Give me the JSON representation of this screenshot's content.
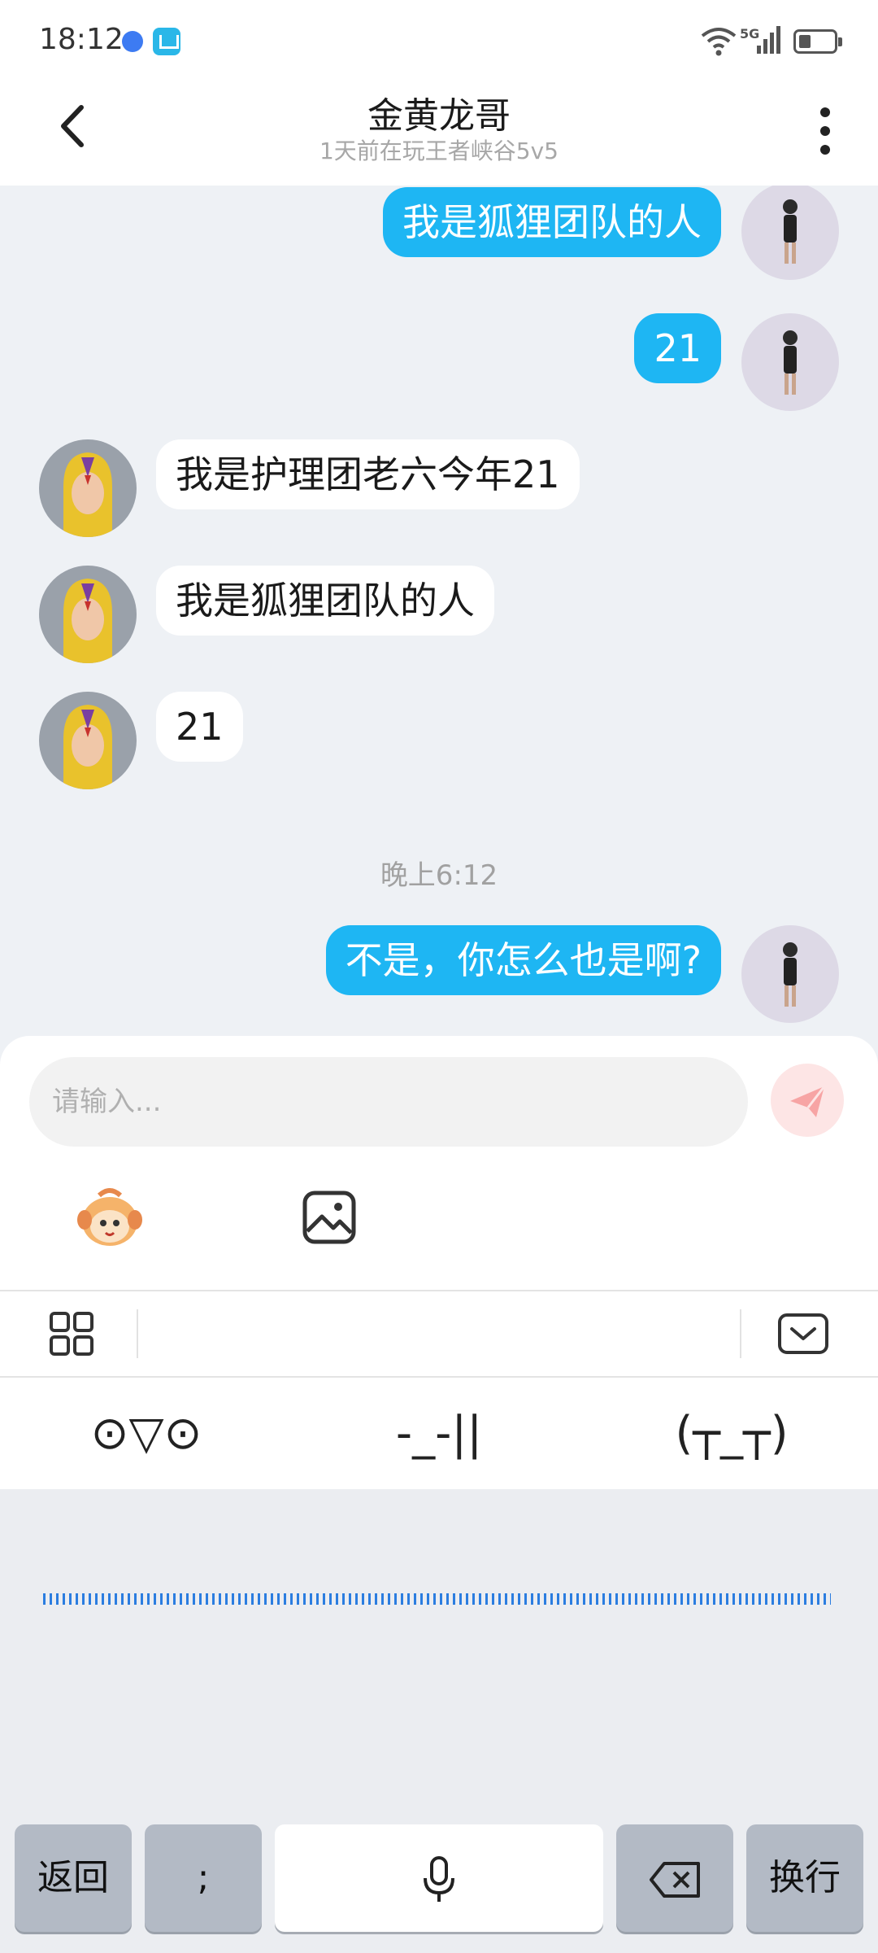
{
  "status_bar": {
    "time": "18:12",
    "network": "5G"
  },
  "header": {
    "title": "金黄龙哥",
    "subtitle": "1天前在玩王者峡谷5v5"
  },
  "messages": [
    {
      "side": "out",
      "text": "我是狐狸团队的人"
    },
    {
      "side": "out",
      "text": "21"
    },
    {
      "side": "in",
      "text": "我是护理团老六今年21"
    },
    {
      "side": "in",
      "text": "我是狐狸团队的人"
    },
    {
      "side": "in",
      "text": "21"
    },
    {
      "side": "out",
      "text": "不是，你怎么也是啊?"
    }
  ],
  "timestamp": "晚上6:12",
  "composer": {
    "placeholder": "请输入..."
  },
  "kaomoji": [
    "⊙▽⊙",
    "-_-||",
    "(┬_┬)"
  ],
  "keyboard": {
    "back_label": "返回",
    "semicolon_label": ";",
    "newline_label": "换行"
  },
  "colors": {
    "outgoing_bubble": "#1eb6f3",
    "incoming_bubble": "#ffffff",
    "send_button": "#f7a4a4"
  }
}
